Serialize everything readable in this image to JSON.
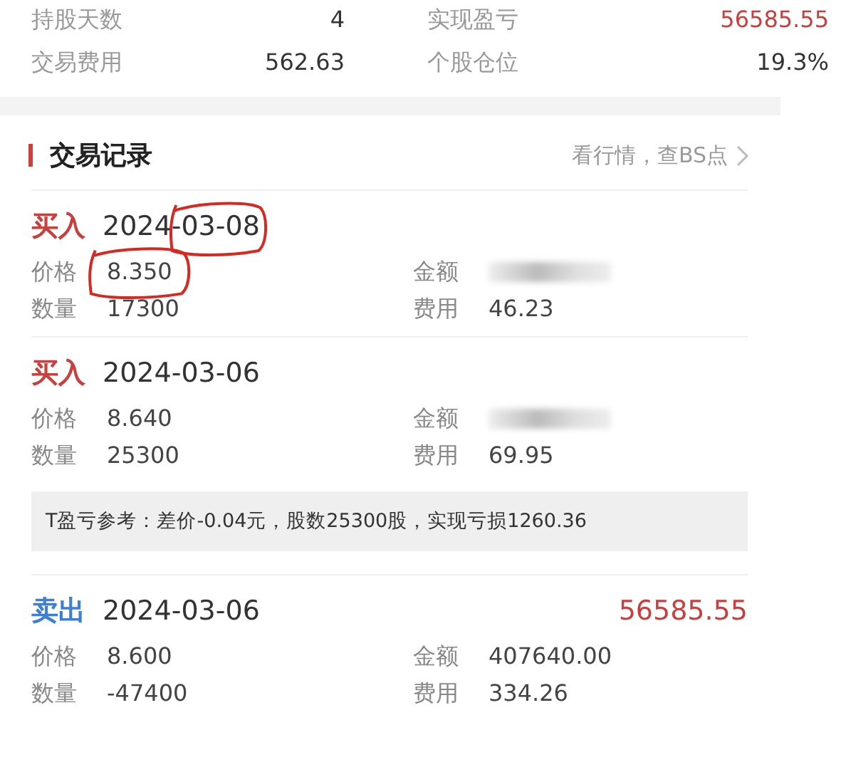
{
  "summary": [
    {
      "label": "持股天数",
      "value": "4",
      "color": "#333333"
    },
    {
      "label": "实现盈亏",
      "value": "56585.55",
      "color": "#c8403d"
    },
    {
      "label": "交易费用",
      "value": "562.63",
      "color": "#333333"
    },
    {
      "label": "个股仓位",
      "value": "19.3%",
      "color": "#333333"
    }
  ],
  "section": {
    "title": "交易记录",
    "link": "看行情，查BS点"
  },
  "records": [
    {
      "kind": "buy",
      "action": "买入",
      "date": "2024-03-08",
      "date_circled": true,
      "fields": [
        {
          "label": "价格",
          "value": "8.350",
          "circled": true
        },
        {
          "label": "金额",
          "masked": true
        },
        {
          "label": "数量",
          "value": "17300"
        },
        {
          "label": "费用",
          "value": "46.23"
        }
      ]
    },
    {
      "kind": "buy",
      "action": "买入",
      "date": "2024-03-06",
      "fields": [
        {
          "label": "价格",
          "value": "8.640"
        },
        {
          "label": "金额",
          "masked": true
        },
        {
          "label": "数量",
          "value": "25300"
        },
        {
          "label": "费用",
          "value": "69.95"
        }
      ],
      "note": "T盈亏参考：差价-0.04元，股数25300股，实现亏损1260.36"
    },
    {
      "kind": "sell",
      "action": "卖出",
      "date": "2024-03-06",
      "profit": "56585.55",
      "fields": [
        {
          "label": "价格",
          "value": "8.600"
        },
        {
          "label": "金额",
          "value": "407640.00"
        },
        {
          "label": "数量",
          "value": "-47400"
        },
        {
          "label": "费用",
          "value": "334.26"
        }
      ]
    }
  ]
}
